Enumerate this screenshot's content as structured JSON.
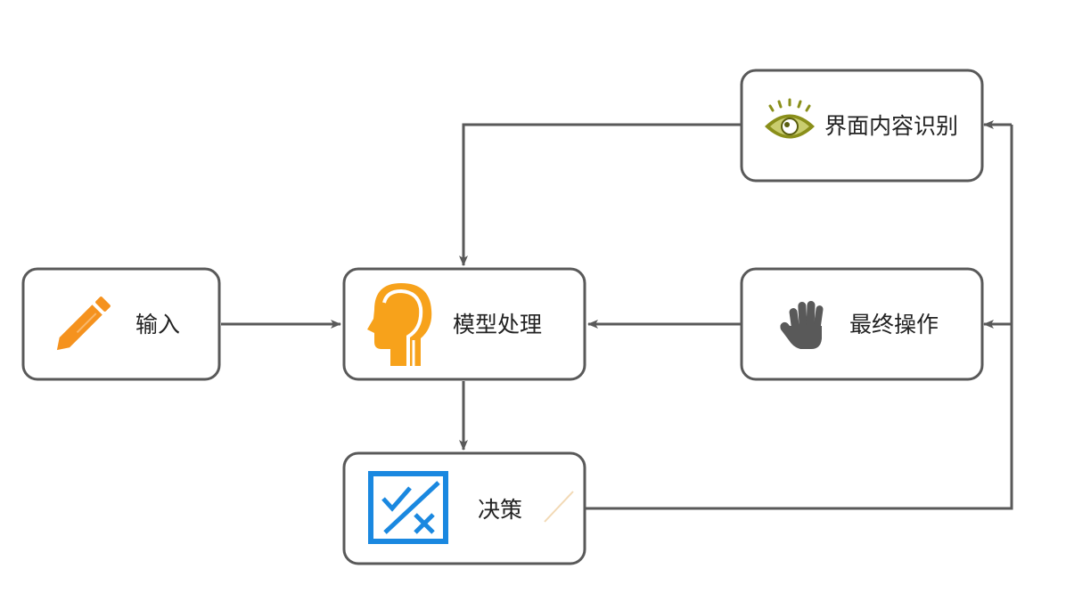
{
  "nodes": {
    "input": {
      "label": "输入",
      "icon": "pencil-icon"
    },
    "model": {
      "label": "模型处理",
      "icon": "head-icon"
    },
    "decision": {
      "label": "决策",
      "icon": "decision-check-icon"
    },
    "recognition": {
      "label": "界面内容识别",
      "icon": "eye-icon"
    },
    "operation": {
      "label": "最终操作",
      "icon": "hand-icon"
    }
  },
  "colors": {
    "node_border": "#595959",
    "edge": "#595959",
    "pencil": "#f5921e",
    "head": "#f7a21b",
    "decision": "#1a88e0",
    "eye": "#8a8f1a",
    "hand": "#595959"
  },
  "edges": [
    {
      "from": "input",
      "to": "model"
    },
    {
      "from": "recognition",
      "to": "model"
    },
    {
      "from": "operation",
      "to": "model"
    },
    {
      "from": "model",
      "to": "decision"
    },
    {
      "from": "decision",
      "to": "recognition"
    },
    {
      "from": "decision",
      "to": "operation"
    }
  ]
}
